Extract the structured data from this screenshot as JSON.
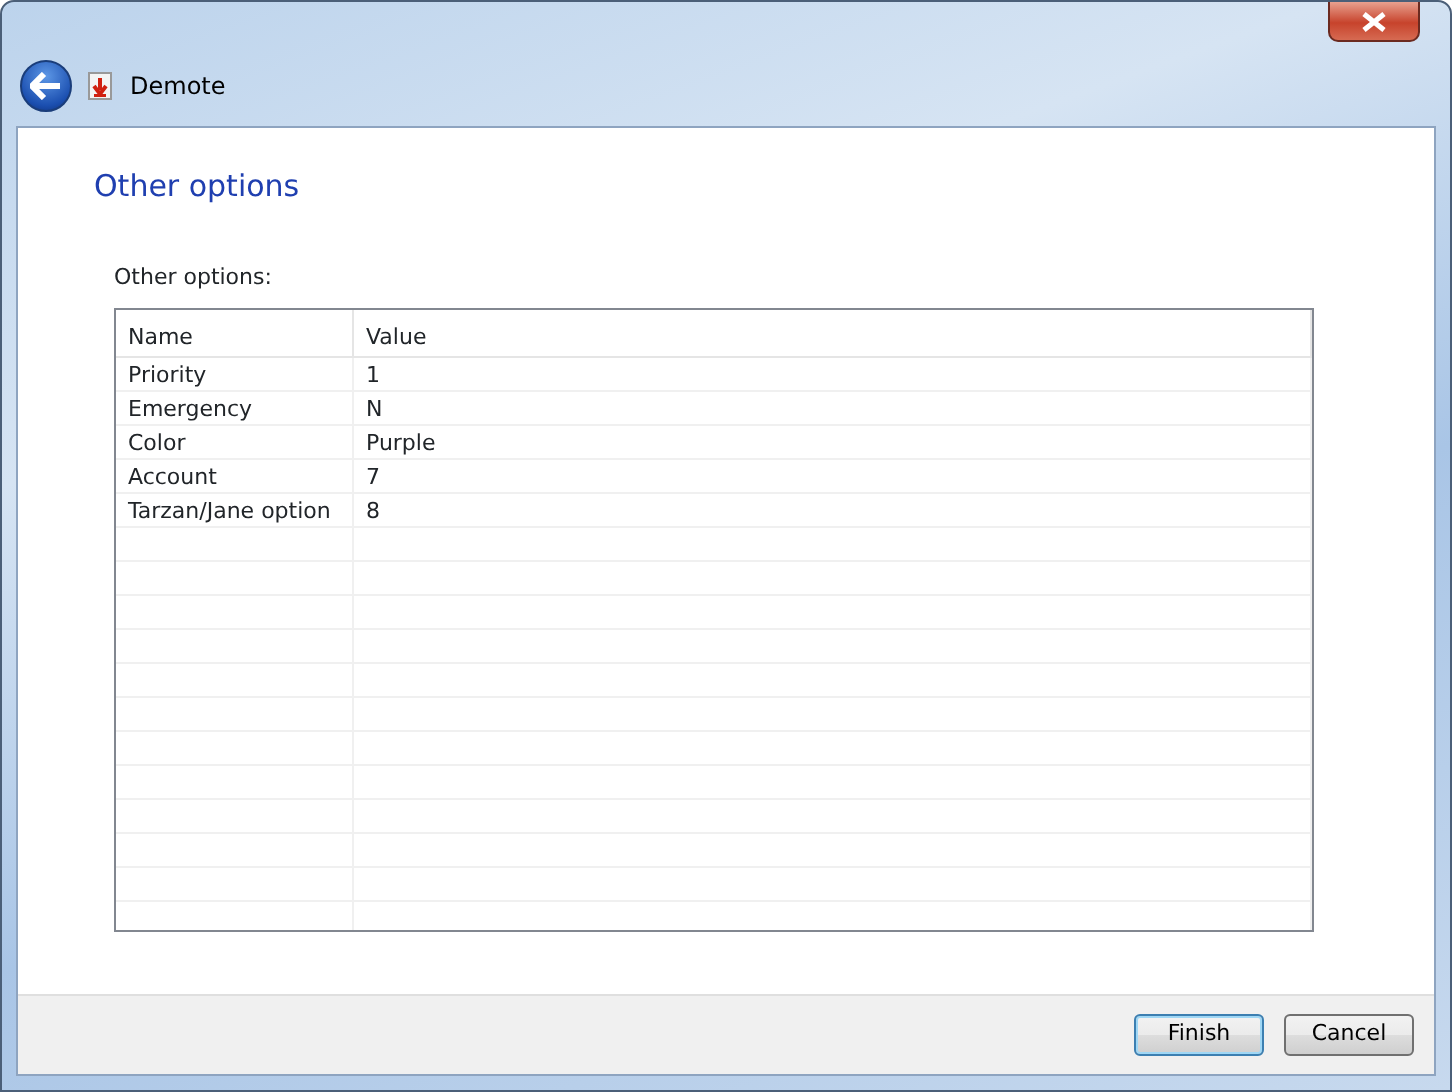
{
  "window": {
    "title": "Demote"
  },
  "page": {
    "heading": "Other options",
    "group_label": "Other options:"
  },
  "table": {
    "columns": [
      "Name",
      "Value"
    ],
    "rows": [
      {
        "name": "Priority",
        "value": "1"
      },
      {
        "name": "Emergency",
        "value": "N"
      },
      {
        "name": "Color",
        "value": "Purple"
      },
      {
        "name": "Account",
        "value": "7"
      },
      {
        "name": "Tarzan/Jane option",
        "value": "8"
      }
    ]
  },
  "buttons": [
    {
      "label": "Finish",
      "default": true
    },
    {
      "label": "Cancel",
      "default": false
    }
  ]
}
